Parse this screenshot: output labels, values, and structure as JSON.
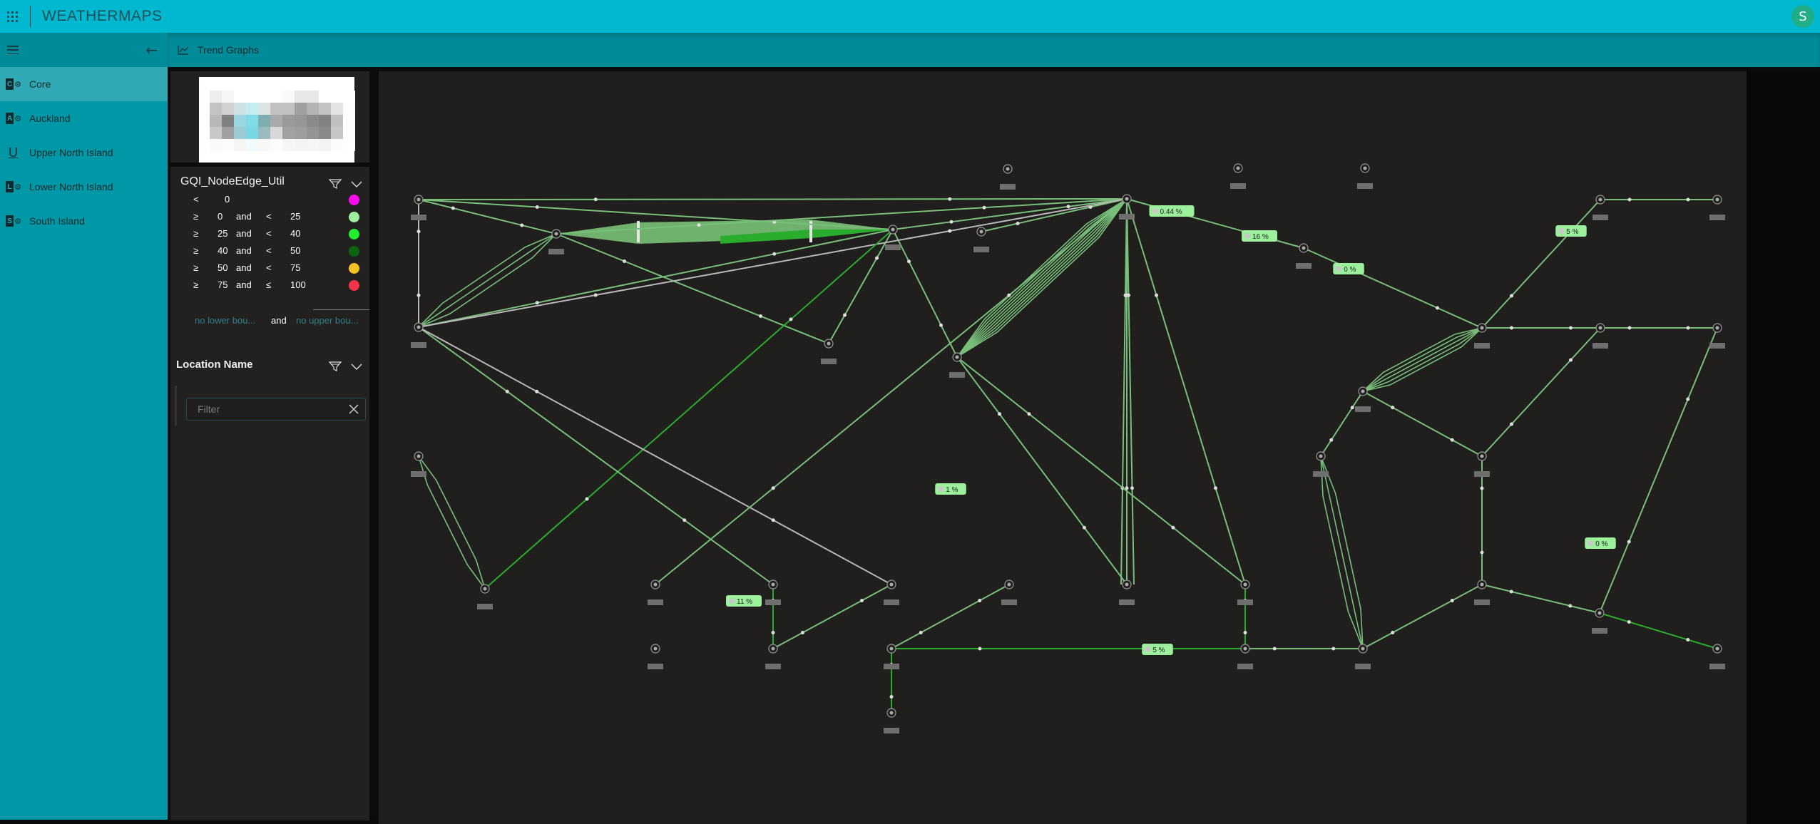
{
  "app": {
    "title": "WEATHERMAPS",
    "user_initial": "S",
    "colors": {
      "topbar": "#00b9d0",
      "sidebar": "#0097a7",
      "active": "#30a9b5",
      "avatar": "#21ad86"
    }
  },
  "sidebar": {
    "items": [
      {
        "label": "Core",
        "icon_letter": "C",
        "icon": "sharepoint-site-icon",
        "active": true
      },
      {
        "label": "Auckland",
        "icon_letter": "A",
        "icon": "sharepoint-site-icon",
        "active": false
      },
      {
        "label": "Upper North Island",
        "icon_letter": "U",
        "icon": "underline-u-icon",
        "active": false
      },
      {
        "label": "Lower North Island",
        "icon_letter": "L",
        "icon": "sharepoint-site-icon",
        "active": false
      },
      {
        "label": "South Island",
        "icon_letter": "S",
        "icon": "sharepoint-site-icon",
        "active": false
      }
    ]
  },
  "subbar": {
    "label": "Trend Graphs",
    "icon": "line-chart-icon"
  },
  "legend": {
    "title": "GQI_NodeEdge_Util",
    "rows": [
      {
        "op1": "<",
        "v1": "0",
        "and": "",
        "op2": "",
        "v2": "",
        "color": "#ff0bf0"
      },
      {
        "op1": "≥",
        "v1": "0",
        "and": "and",
        "op2": "<",
        "v2": "25",
        "color": "#9ef0a0"
      },
      {
        "op1": "≥",
        "v1": "25",
        "and": "and",
        "op2": "<",
        "v2": "40",
        "color": "#22ee30"
      },
      {
        "op1": "≥",
        "v1": "40",
        "and": "and",
        "op2": "<",
        "v2": "50",
        "color": "#0b6410"
      },
      {
        "op1": "≥",
        "v1": "50",
        "and": "and",
        "op2": "<",
        "v2": "75",
        "color": "#f6c422"
      },
      {
        "op1": "≥",
        "v1": "75",
        "and": "and",
        "op2": "≤",
        "v2": "100",
        "color": "#f2344a"
      }
    ],
    "lower_bound": "no lower bou...",
    "and": "and",
    "upper_bound": "no upper bou..."
  },
  "location_filter": {
    "title": "Location Name",
    "placeholder": "Filter",
    "value": ""
  },
  "map": {
    "labels": [
      {
        "text": "0.44 %"
      },
      {
        "text": "16 %"
      },
      {
        "text": "0 %"
      },
      {
        "text": "5 %"
      },
      {
        "text": "1 %"
      },
      {
        "text": "11 %"
      },
      {
        "text": "5 %"
      },
      {
        "text": "0 %"
      }
    ]
  }
}
